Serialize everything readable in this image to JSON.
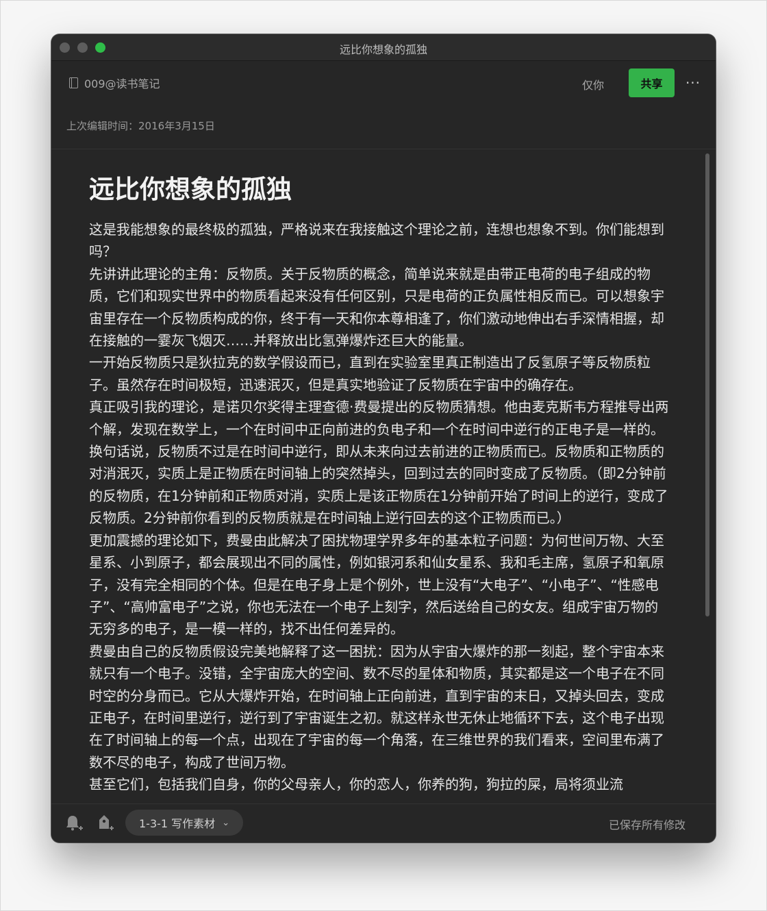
{
  "window": {
    "title": "远比你想象的孤独"
  },
  "header": {
    "notebook": "009@读书笔记",
    "visibility": "仅你",
    "share_label": "共享",
    "more_label": "···",
    "last_edited_label": "上次编辑时间：",
    "last_edited_date": "2016年3月15日"
  },
  "note": {
    "title": "远比你想象的孤独",
    "paragraphs": [
      "这是我能想象的最终极的孤独，严格说来在我接触这个理论之前，连想也想象不到。你们能想到吗？",
      "先讲讲此理论的主角：反物质。关于反物质的概念，简单说来就是由带正电荷的电子组成的物质，它们和现实世界中的物质看起来没有任何区别，只是电荷的正负属性相反而已。可以想象宇宙里存在一个反物质构成的你，终于有一天和你本尊相逢了，你们激动地伸出右手深情相握，却在接触的一霎灰飞烟灭……并释放出比氢弹爆炸还巨大的能量。",
      "一开始反物质只是狄拉克的数学假设而已，直到在实验室里真正制造出了反氢原子等反物质粒子。虽然存在时间极短，迅速泯灭，但是真实地验证了反物质在宇宙中的确存在。",
      "真正吸引我的理论，是诺贝尔奖得主理查德·费曼提出的反物质猜想。他由麦克斯韦方程推导出两个解，发现在数学上，一个在时间中正向前进的负电子和一个在时间中逆行的正电子是一样的。换句话说，反物质不过是在时间中逆行，即从未来向过去前进的正物质而已。反物质和正物质的对消泯灭，实质上是正物质在时间轴上的突然掉头，回到过去的同时变成了反物质。（即2分钟前的反物质，在1分钟前和正物质对消，实质上是该正物质在1分钟前开始了时间上的逆行，变成了反物质。2分钟前你看到的反物质就是在时间轴上逆行回去的这个正物质而已。）",
      "更加震撼的理论如下，费曼由此解决了困扰物理学界多年的基本粒子问题：为何世间万物、大至星系、小到原子，都会展现出不同的属性，例如银河系和仙女星系、我和毛主席，氢原子和氧原子，没有完全相同的个体。但是在电子身上是个例外，世上没有“大电子”、“小电子”、“性感电子”、“高帅富电子”之说，你也无法在一个电子上刻字，然后送给自己的女友。组成宇宙万物的无穷多的电子，是一模一样的，找不出任何差异的。",
      "费曼由自己的反物质假设完美地解释了这一困扰：因为从宇宙大爆炸的那一刻起，整个宇宙本来就只有一个电子。没错，全宇宙庞大的空间、数不尽的星体和物质，其实都是这一个电子在不同时空的分身而已。它从大爆炸开始，在时间轴上正向前进，直到宇宙的末日，又掉头回去，变成正电子，在时间里逆行，逆行到了宇宙诞生之初。就这样永世无休止地循环下去，这个电子出现在了时间轴上的每一个点，出现在了宇宙的每一个角落，在三维世界的我们看来，空间里布满了数不尽的电子，构成了世间万物。",
      "甚至它们，包括我们自身，你的父母亲人，你的恋人，你养的狗，狗拉的屎，局将须业流"
    ]
  },
  "footer": {
    "tag_label": "1-3-1 写作素材",
    "save_status": "已保存所有修改"
  }
}
